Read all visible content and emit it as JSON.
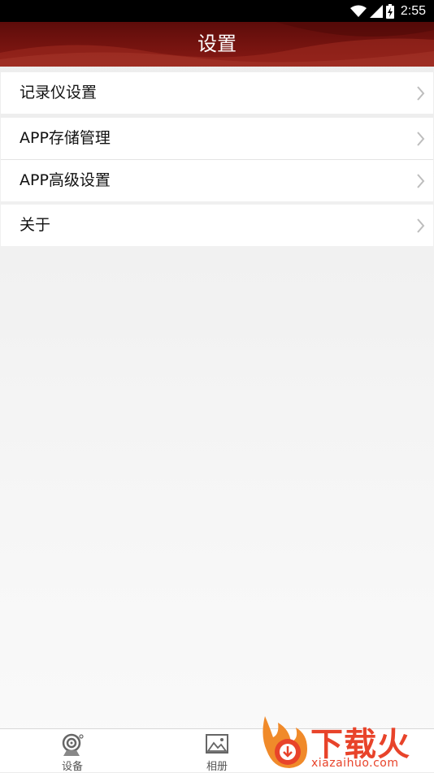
{
  "status_bar": {
    "time": "2:55",
    "icons": [
      "wifi-icon",
      "cell-signal-icon",
      "battery-charging-icon"
    ]
  },
  "header": {
    "title": "设置"
  },
  "settings": {
    "groups": [
      {
        "items": [
          {
            "label": "记录仪设置"
          }
        ]
      },
      {
        "items": [
          {
            "label": "APP存储管理"
          },
          {
            "label": "APP高级设置"
          }
        ]
      },
      {
        "items": [
          {
            "label": "关于"
          }
        ]
      }
    ]
  },
  "bottom_nav": {
    "items": [
      {
        "label": "设备",
        "icon": "camera-icon"
      },
      {
        "label": "相册",
        "icon": "album-icon"
      }
    ]
  },
  "watermark": {
    "brand": "下载火",
    "url": "xiazaihuo.com",
    "logo": "flame-logo"
  },
  "colors": {
    "header": "#7a1510",
    "watermark": "#e8432a",
    "background": "#efefef"
  }
}
